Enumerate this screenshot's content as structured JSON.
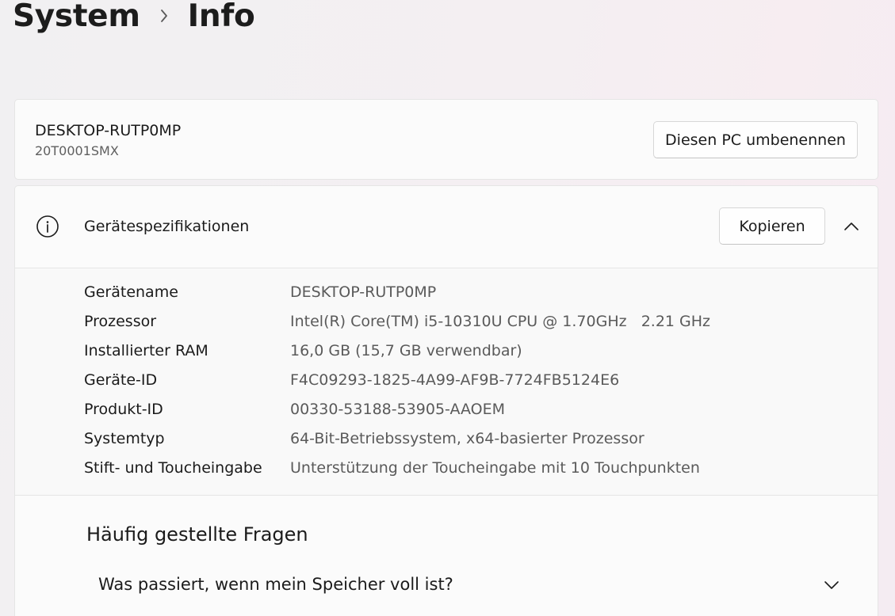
{
  "breadcrumb": {
    "parent": "System",
    "current": "Info"
  },
  "pc": {
    "name": "DESKTOP-RUTP0MP",
    "model": "20T0001SMX",
    "rename_label": "Diesen PC umbenennen"
  },
  "specs": {
    "title": "Gerätespezifikationen",
    "copy_label": "Kopieren",
    "rows": [
      {
        "label": "Gerätename",
        "value": "DESKTOP-RUTP0MP"
      },
      {
        "label": "Prozessor",
        "value": "Intel(R) Core(TM) i5-10310U CPU @ 1.70GHz   2.21 GHz"
      },
      {
        "label": "Installierter RAM",
        "value": "16,0 GB (15,7 GB verwendbar)"
      },
      {
        "label": "Geräte-ID",
        "value": "F4C09293-1825-4A99-AF9B-7724FB5124E6"
      },
      {
        "label": "Produkt-ID",
        "value": "00330-53188-53905-AAOEM"
      },
      {
        "label": "Systemtyp",
        "value": "64-Bit-Betriebssystem, x64-basierter Prozessor"
      },
      {
        "label": "Stift- und Toucheingabe",
        "value": "Unterstützung der Toucheingabe mit 10 Touchpunkten"
      }
    ]
  },
  "faq": {
    "title": "Häufig gestellte Fragen",
    "items": [
      {
        "question": "Was passiert, wenn mein Speicher voll ist?"
      }
    ]
  },
  "icons": {
    "breadcrumb_separator": "chevron-right-icon",
    "specs_icon": "info-icon",
    "collapse": "chevron-up-icon",
    "faq_expand": "chevron-down-icon"
  }
}
